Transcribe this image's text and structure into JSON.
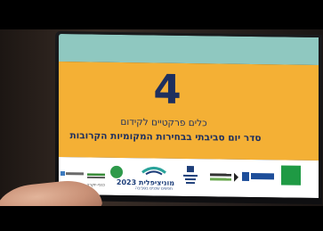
{
  "slide": {
    "number": "4",
    "line1": "כלים פרקטיים לקידום",
    "line2": "סדר יום סביבתי בבחירות המקומיות הקרובות"
  },
  "logos": {
    "municipal_title": "מוניציפלית 2023",
    "municipal_subtitle": "חפשים שכנים בסביבה",
    "shelach_text": "שלה",
    "org_left_text": "כנפי-יוקרה",
    "org_right_text": "חברה להגנת הטבע",
    "org_mid_text": "החברה לשמירת הטבע",
    "green_logo_text": "גרין"
  },
  "colors": {
    "teal_band": "#8fc8c0",
    "orange_panel": "#f4b035",
    "navy_text": "#1e2f5e",
    "logo_strip": "#ffffff"
  }
}
